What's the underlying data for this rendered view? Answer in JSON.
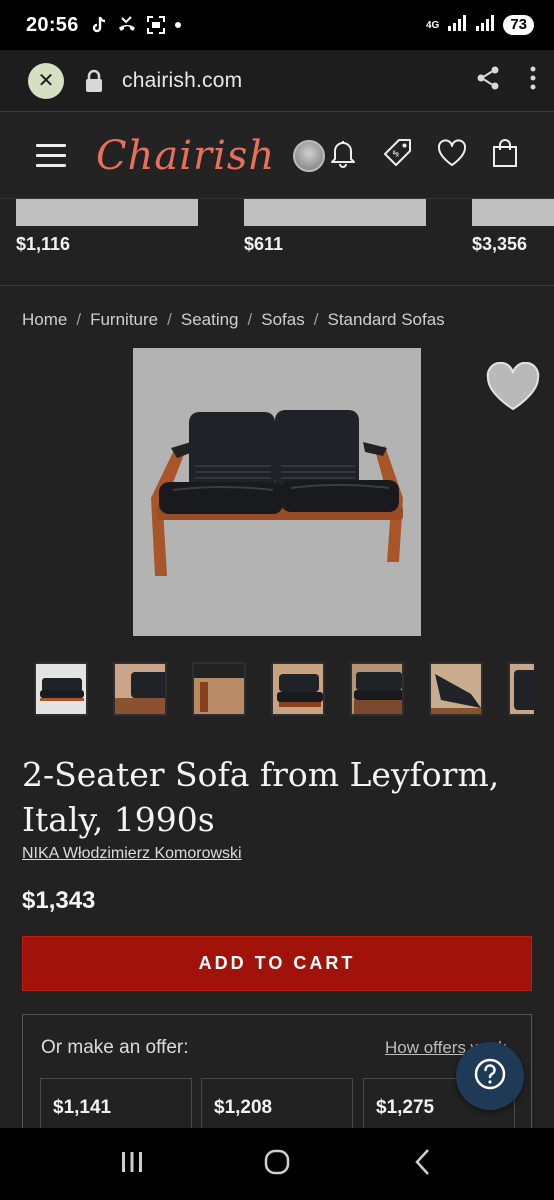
{
  "status": {
    "time": "20:56",
    "network": "4G",
    "battery": "73"
  },
  "browser": {
    "url": "chairish.com"
  },
  "site": {
    "logo": "Chairish",
    "brand_color": "#e8705b"
  },
  "related": [
    {
      "price": "$1,116"
    },
    {
      "price": "$611"
    },
    {
      "price": "$3,356"
    }
  ],
  "breadcrumb": [
    "Home",
    "Furniture",
    "Seating",
    "Sofas",
    "Standard Sofas"
  ],
  "product": {
    "title": "2-Seater Sofa from Leyform, Italy, 1990s",
    "designer": "NIKA Włodzimierz Komorowski",
    "price": "$1,343",
    "add_to_cart": "ADD TO CART",
    "cart_color": "#a0120a"
  },
  "offer": {
    "label": "Or make an offer:",
    "how_link": "How offers work",
    "options": [
      "$1,141",
      "$1,208",
      "$1,275"
    ]
  },
  "icons": [
    "close-icon",
    "lock-icon",
    "share-icon",
    "more-icon",
    "menu-icon",
    "bell-icon",
    "tag-icon",
    "heart-icon",
    "bag-icon",
    "help-icon",
    "recents-icon",
    "home-icon",
    "back-icon"
  ]
}
